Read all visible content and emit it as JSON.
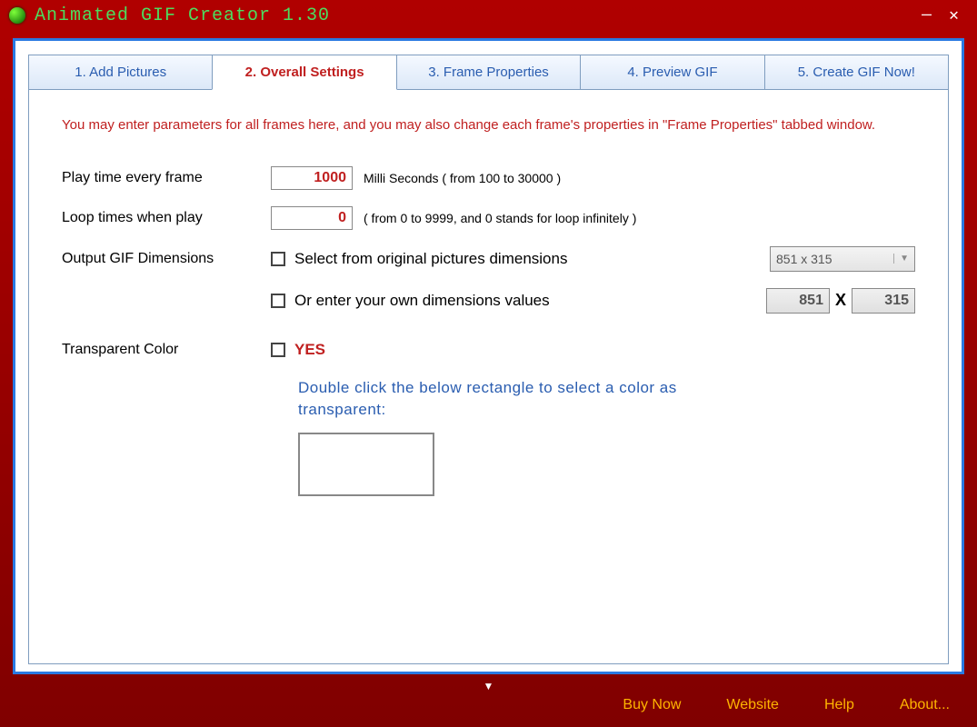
{
  "window": {
    "title": "Animated GIF Creator 1.30"
  },
  "tabs": {
    "t1": "1. Add Pictures",
    "t2": "2. Overall Settings",
    "t3": "3. Frame Properties",
    "t4": "4. Preview GIF",
    "t5": "5. Create GIF Now!"
  },
  "desc": "You may enter parameters for all frames here, and you may also change each frame's properties in \"Frame Properties\" tabbed window.",
  "labels": {
    "play_time": "Play time every frame",
    "loop_times": "Loop times when play",
    "output_dim": "Output GIF Dimensions",
    "transparent": "Transparent Color"
  },
  "values": {
    "play_time": "1000",
    "loop_times": "0",
    "dim_preset": "851 x 315",
    "dim_w": "851",
    "dim_h": "315",
    "dim_x": "X"
  },
  "hints": {
    "play_time": "Milli Seconds ( from 100 to 30000 )",
    "loop_times": "( from 0 to 9999, and 0 stands for loop infinitely )"
  },
  "checkbox_labels": {
    "select_original": "Select from original pictures dimensions",
    "enter_own": "Or enter your own dimensions values",
    "yes": "YES"
  },
  "instruction": "Double click the below rectangle to select a color as transparent:",
  "footer": {
    "buy": "Buy Now",
    "website": "Website",
    "help": "Help",
    "about": "About..."
  }
}
